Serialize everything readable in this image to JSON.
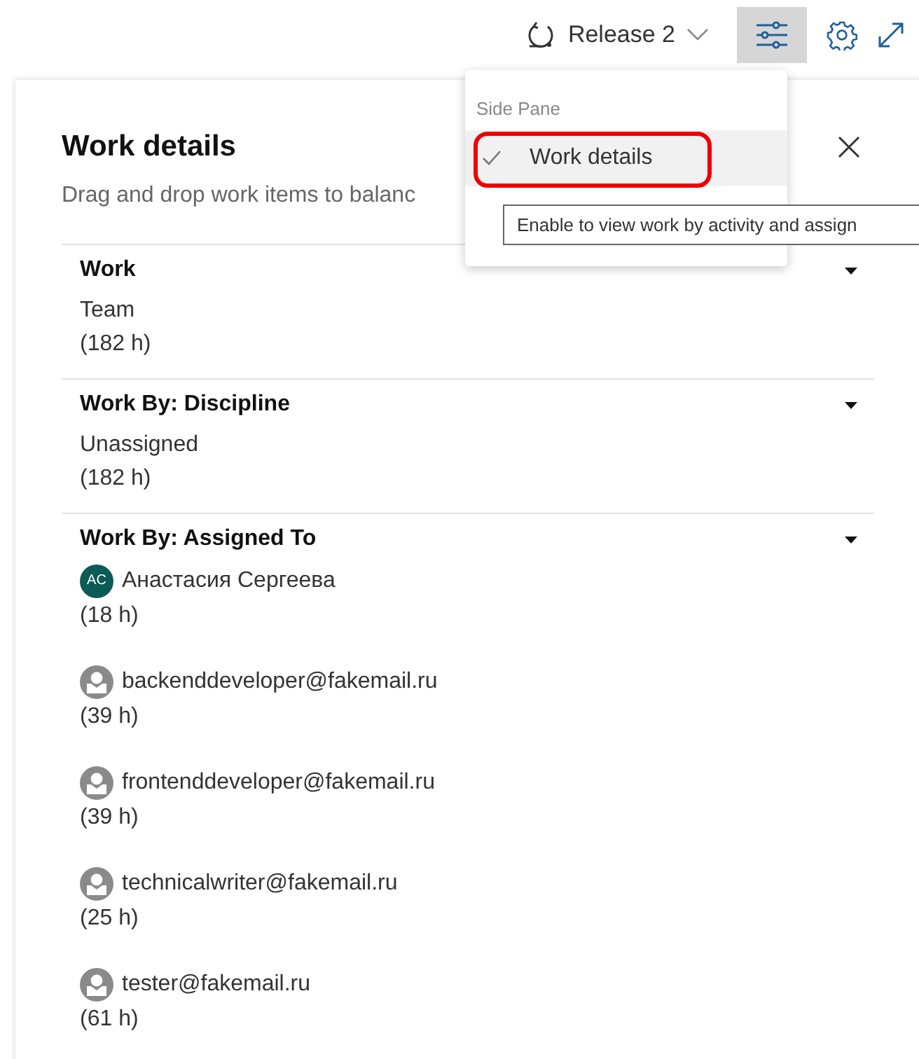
{
  "toolbar": {
    "iteration": "Release 2",
    "filter_button": {
      "selected": true
    }
  },
  "menu": {
    "heading": "Side Pane",
    "items": [
      {
        "label": "Work details",
        "checked": true,
        "annotated": true
      }
    ]
  },
  "tooltip": "Enable to view work by activity and assign",
  "panel": {
    "title": "Work details",
    "subtitle": "Drag and drop work items to balanc",
    "sections": [
      {
        "heading": "Work",
        "expanded": true,
        "entries": [
          {
            "name": "Team",
            "hours": "(182 h)"
          }
        ]
      },
      {
        "heading": "Work By: Discipline",
        "expanded": true,
        "entries": [
          {
            "name": "Unassigned",
            "hours": "(182 h)"
          }
        ]
      },
      {
        "heading": "Work By: Assigned To",
        "expanded": true,
        "entries": [
          {
            "name": "Анастасия Сергеева",
            "hours": "(18 h)",
            "avatar": {
              "kind": "initials",
              "initials": "AC",
              "color": "#0b5a55"
            }
          },
          {
            "name": "backenddeveloper@fakemail.ru",
            "hours": "(39 h)",
            "avatar": {
              "kind": "generic"
            }
          },
          {
            "name": "frontenddeveloper@fakemail.ru",
            "hours": "(39 h)",
            "avatar": {
              "kind": "generic"
            }
          },
          {
            "name": "technicalwriter@fakemail.ru",
            "hours": "(25 h)",
            "avatar": {
              "kind": "generic"
            }
          },
          {
            "name": "tester@fakemail.ru",
            "hours": "(61 h)",
            "avatar": {
              "kind": "generic"
            }
          }
        ]
      }
    ]
  }
}
